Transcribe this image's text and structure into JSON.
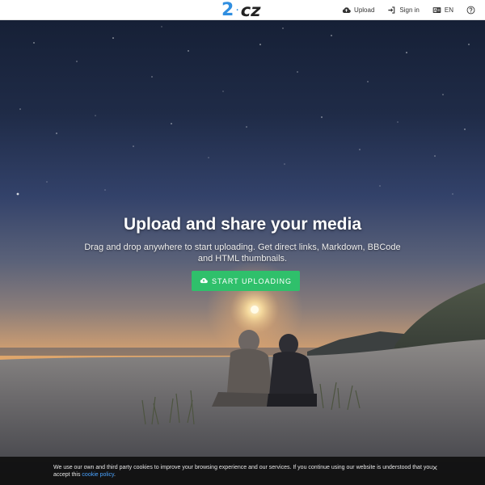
{
  "header": {
    "logo": {
      "number": "2",
      "separator": "·",
      "rest": "cz"
    },
    "nav": [
      {
        "label": "Upload",
        "icon": "cloud-upload-icon"
      },
      {
        "label": "Sign in",
        "icon": "sign-in-icon"
      },
      {
        "label": "EN",
        "icon": "language-icon"
      },
      {
        "label": "",
        "icon": "help-icon"
      }
    ]
  },
  "hero": {
    "title": "Upload and share your media",
    "subtitle": "Drag and drop anywhere to start uploading. Get direct links, Markdown, BBCode and HTML thumbnails.",
    "cta_label": "START UPLOADING",
    "cta_icon": "cloud-upload-icon"
  },
  "cookie": {
    "text": "We use our own and third party cookies to improve your browsing experience and our services. If you continue using our website is understood that you accept this ",
    "link_label": "cookie policy",
    "suffix": ".",
    "close_icon": "close-icon"
  },
  "colors": {
    "accent": "#2fc06b",
    "logo_blue": "#2f8ee0",
    "link": "#4aa3ff"
  }
}
